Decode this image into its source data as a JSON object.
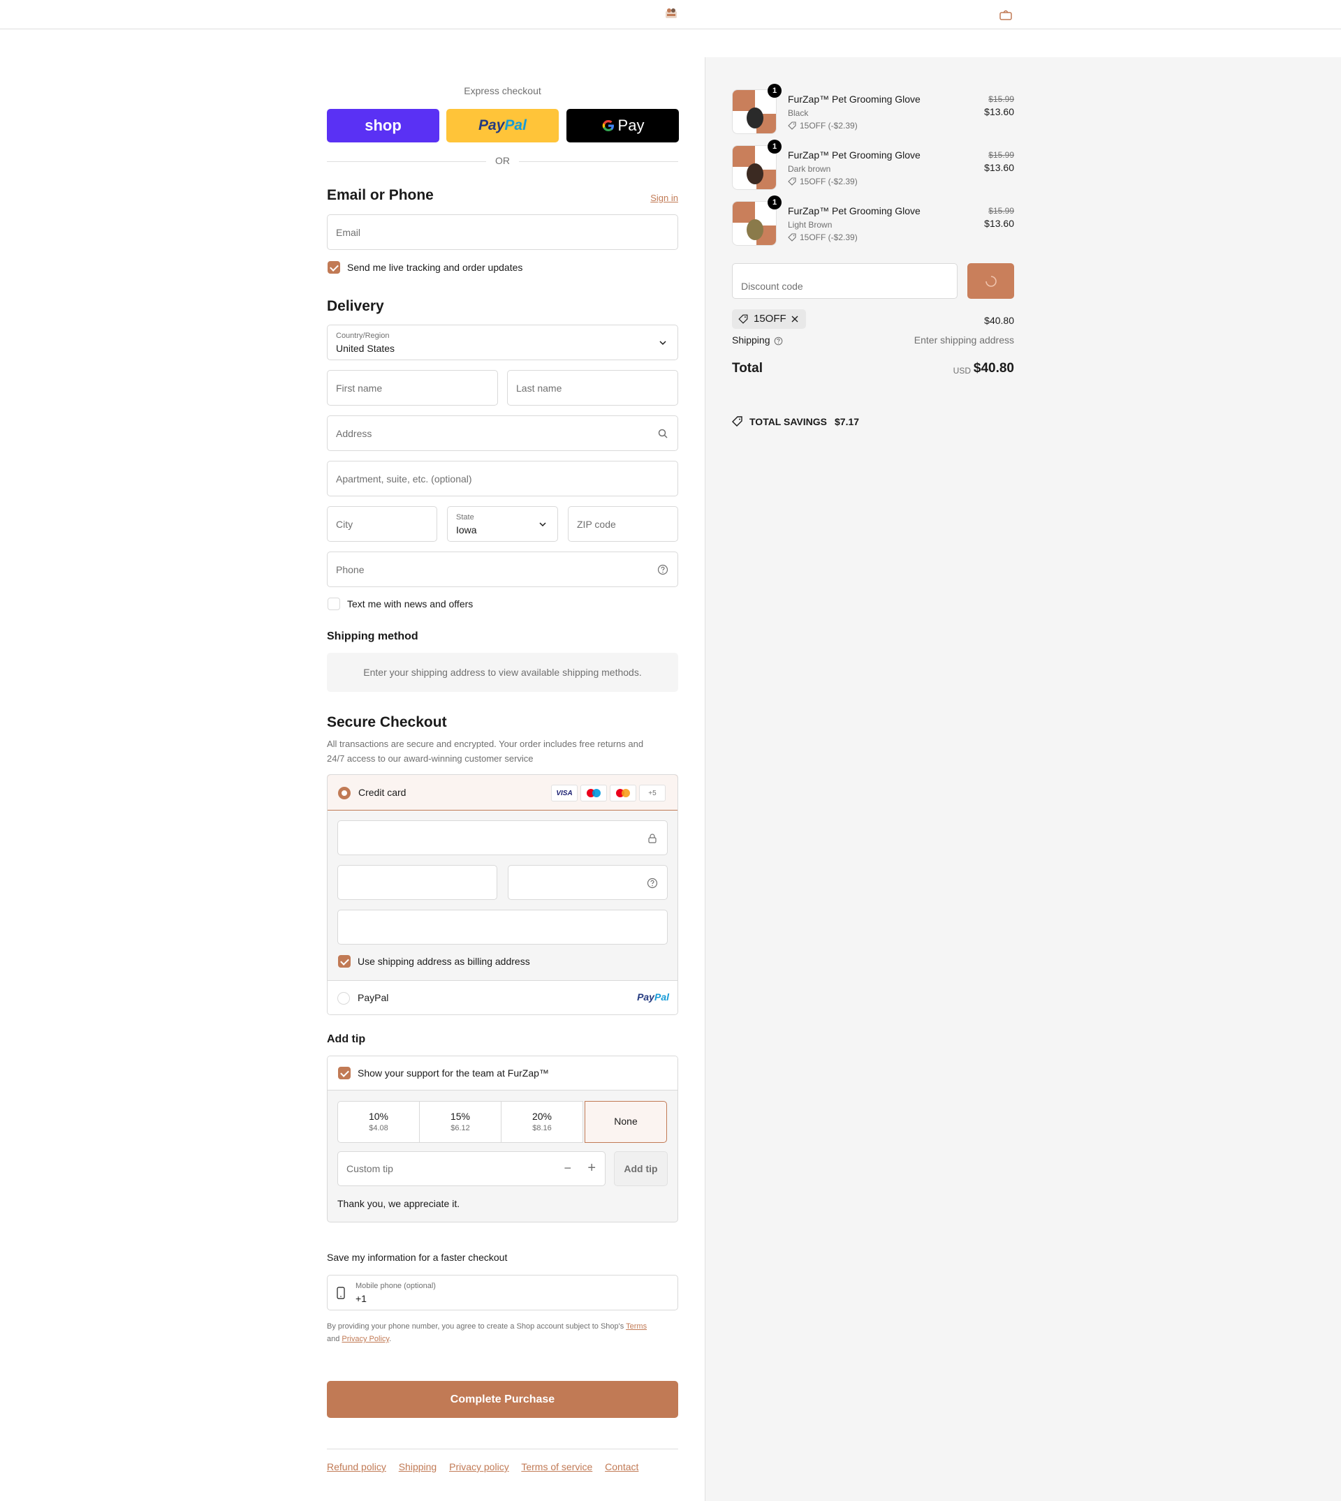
{
  "header": {
    "logo_icon": "furzap-logo-icon",
    "cart_icon": "shopping-bag-icon"
  },
  "express": {
    "label": "Express checkout",
    "shop_label": "shop",
    "paypal_label_1": "Pay",
    "paypal_label_2": "Pal",
    "gpay_label": "Pay",
    "or_label": "OR"
  },
  "contact": {
    "title": "Email or Phone",
    "sign_in": "Sign in",
    "email_placeholder": "Email",
    "tracking_label": "Send me live tracking and order updates",
    "tracking_checked": true
  },
  "delivery": {
    "title": "Delivery",
    "country_label": "Country/Region",
    "country_value": "United States",
    "first_name_placeholder": "First name",
    "last_name_placeholder": "Last name",
    "address_placeholder": "Address",
    "apartment_placeholder": "Apartment, suite, etc. (optional)",
    "city_placeholder": "City",
    "state_label": "State",
    "state_value": "Iowa",
    "zip_placeholder": "ZIP code",
    "phone_placeholder": "Phone",
    "news_label": "Text me with news and offers",
    "news_checked": false
  },
  "shipping_method": {
    "title": "Shipping method",
    "note": "Enter your shipping address to view available shipping methods."
  },
  "payment": {
    "title": "Secure Checkout",
    "description_1": "All transactions are secure and encrypted. Your order includes free returns and",
    "description_2": "24/7 access to our award-winning customer service",
    "credit_card_label": "Credit card",
    "card_brands": [
      "VISA",
      "maestro",
      "mastercard"
    ],
    "more_brands": "+5",
    "billing_label": "Use shipping address as billing address",
    "billing_checked": true,
    "paypal_label": "PayPal",
    "paypal_logo_1": "Pay",
    "paypal_logo_2": "Pal"
  },
  "tip": {
    "title": "Add tip",
    "support_label": "Show your support for the team at FurZap™",
    "options": [
      {
        "percent": "10%",
        "amount": "$4.08"
      },
      {
        "percent": "15%",
        "amount": "$6.12"
      },
      {
        "percent": "20%",
        "amount": "$8.16"
      }
    ],
    "none_label": "None",
    "custom_placeholder": "Custom tip",
    "add_button": "Add tip",
    "thanks": "Thank you, we appreciate it."
  },
  "save_info": {
    "title": "Save my information for a faster checkout",
    "phone_label": "Mobile phone (optional)",
    "phone_prefix": "+1",
    "legal_1": "By providing your phone number, you agree to create a Shop account subject to Shop's",
    "terms": "Terms",
    "legal_and": "and",
    "privacy": "Privacy Policy",
    "legal_end": "."
  },
  "complete_button": "Complete Purchase",
  "footer_links": [
    "Refund policy",
    "Shipping",
    "Privacy policy",
    "Terms of service",
    "Contact"
  ],
  "summary": {
    "products": [
      {
        "name": "FurZap™ Pet Grooming Glove",
        "variant": "Black",
        "discount": "15OFF (-$2.39)",
        "old_price": "$15.99",
        "new_price": "$13.60",
        "qty": "1",
        "color": "#2a2a2a"
      },
      {
        "name": "FurZap™ Pet Grooming Glove",
        "variant": "Dark brown",
        "discount": "15OFF (-$2.39)",
        "old_price": "$15.99",
        "new_price": "$13.60",
        "qty": "1",
        "color": "#3b2a22"
      },
      {
        "name": "FurZap™ Pet Grooming Glove",
        "variant": "Light Brown",
        "discount": "15OFF (-$2.39)",
        "old_price": "$15.99",
        "new_price": "$13.60",
        "qty": "1",
        "color": "#8a7a4a"
      }
    ],
    "discount_placeholder": "Discount code",
    "applied_code": "15OFF",
    "subtotal": "$40.80",
    "shipping_label": "Shipping",
    "shipping_value": "Enter shipping address",
    "total_label": "Total",
    "currency": "USD",
    "total_value": "$40.80",
    "savings_label": "TOTAL SAVINGS",
    "savings_value": "$7.17"
  },
  "colors": {
    "accent": "#c17a55",
    "shop": "#5a31f4",
    "paypal": "#ffc439"
  }
}
